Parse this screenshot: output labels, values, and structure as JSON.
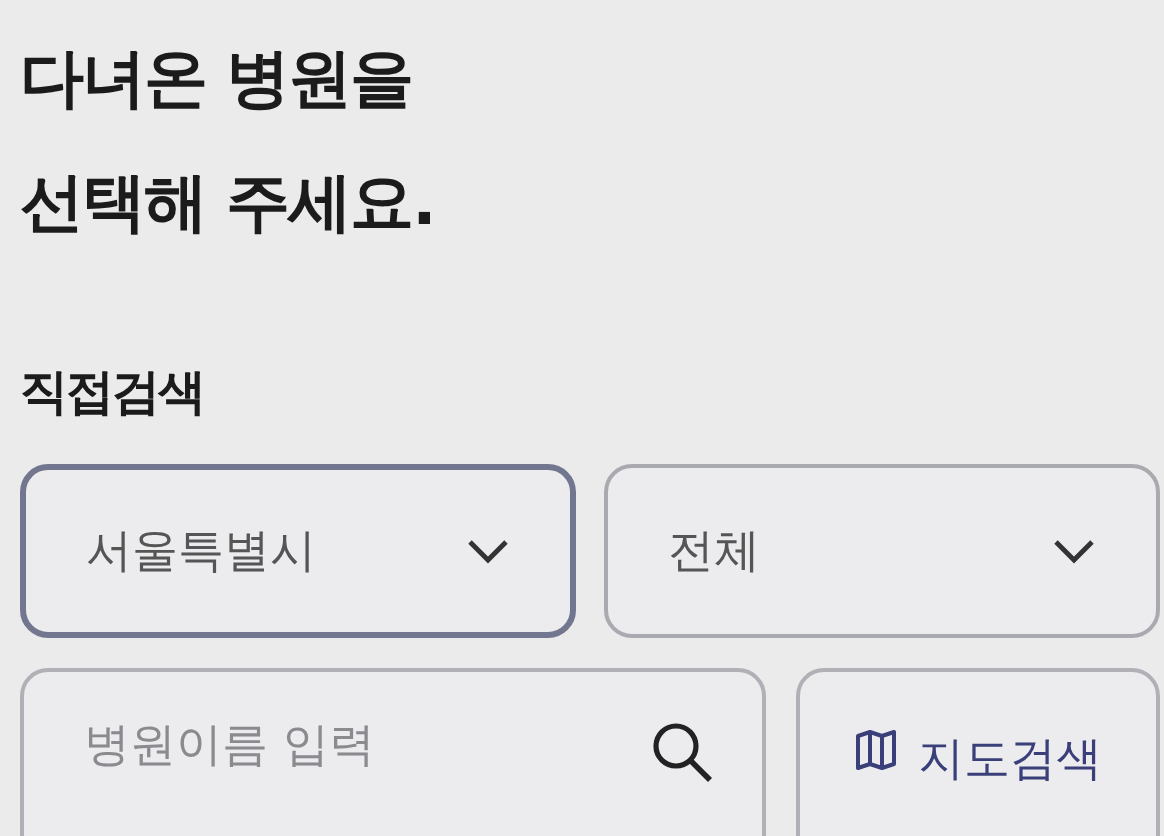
{
  "title_lines": [
    "다녀온 병원을",
    "선택해 주세요."
  ],
  "section_label": "직접검색",
  "dropdowns": [
    {
      "value": "서울특별시",
      "focused": true
    },
    {
      "value": "전체",
      "focused": false
    }
  ],
  "search": {
    "placeholder": "병원이름 입력"
  },
  "map_button": {
    "label": "지도검색"
  }
}
